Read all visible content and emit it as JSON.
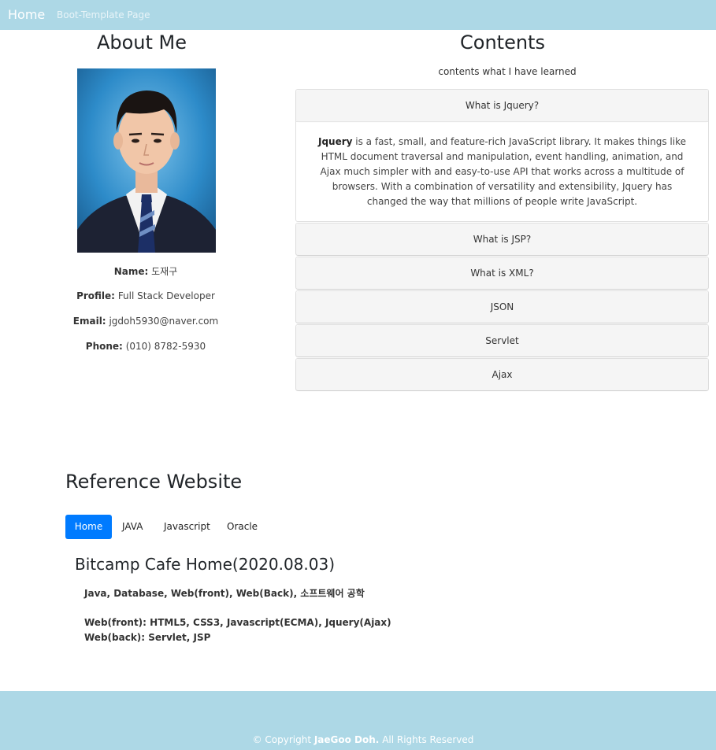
{
  "navbar": {
    "brand": "Home",
    "link": "Boot-Template Page"
  },
  "about": {
    "title": "About Me",
    "name_label": "Name:",
    "name": "도재구",
    "profile_label": "Profile:",
    "profile": "Full Stack Developer",
    "email_label": "Email:",
    "email": "jgdoh5930@naver.com",
    "phone_label": "Phone:",
    "phone": "(010) 8782-5930"
  },
  "contents": {
    "title": "Contents",
    "subtitle": "contents what I have learned",
    "items": [
      {
        "label": "What is Jquery?",
        "body_strong": "Jquery",
        "body": " is a fast, small, and feature-rich JavaScript library. It makes things like HTML document traversal and manipulation, event handling, animation, and Ajax much simpler with and easy-to-use API that works across a multitude of browsers. With a combination of versatility and extensibility, Jquery has changed the way that millions of people write JavaScript."
      },
      {
        "label": "What is JSP?"
      },
      {
        "label": "What is XML?"
      },
      {
        "label": "JSON"
      },
      {
        "label": "Servlet"
      },
      {
        "label": "Ajax"
      }
    ]
  },
  "reference": {
    "title": "Reference Website",
    "tabs": [
      "Home",
      "JAVA",
      "Javascript",
      "Oracle"
    ],
    "active_tab": "Home",
    "panel_title": "Bitcamp Cafe Home(2020.08.03)",
    "line1": "Java, Database, Web(front), Web(Back), 소프트웨어 공학",
    "line2": "Web(front): HTML5, CSS3, Javascript(ECMA), Jquery(Ajax)",
    "line3": "Web(back): Servlet, JSP"
  },
  "footer": {
    "prefix": "© Copyright ",
    "owner": "JaeGoo Doh.",
    "suffix": " All Rights Reserved"
  },
  "colors": {
    "navbar": "#add8e6",
    "active_tab": "#007bff",
    "accordion_head": "#f5f5f5"
  }
}
